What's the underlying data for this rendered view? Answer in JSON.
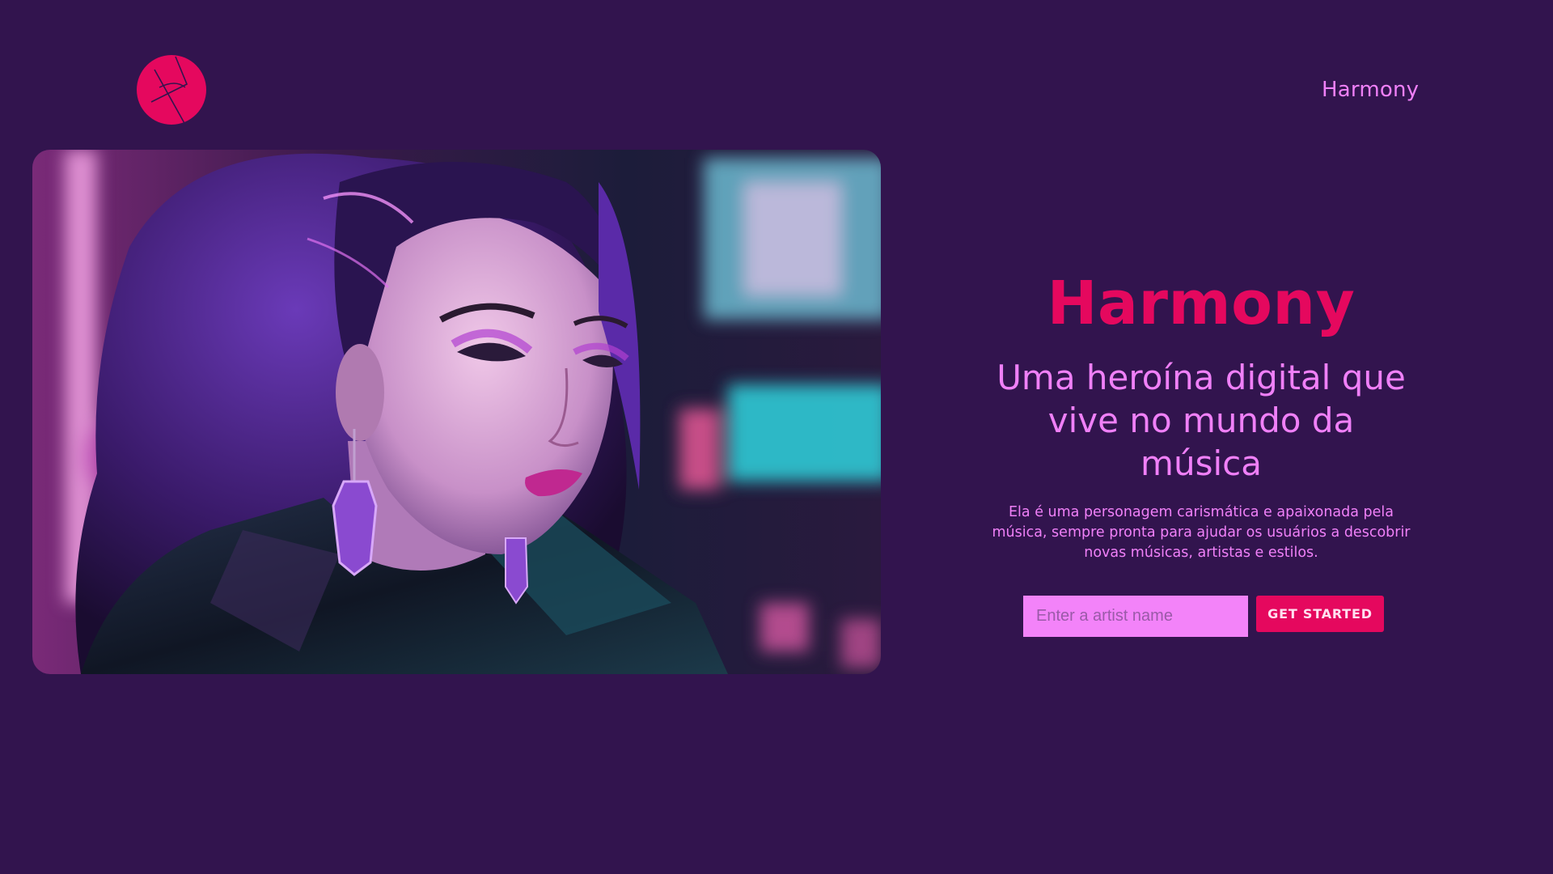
{
  "header": {
    "nav_link": "Harmony"
  },
  "hero": {
    "title": "Harmony",
    "subtitle": "Uma heroína digital que vive no mundo da música",
    "description": "Ela é uma personagem carismática e apaixonada pela música, sempre pronta para ajudar os usuários a descobrir novas músicas, artistas e estilos.",
    "input_placeholder": "Enter a artist name",
    "input_value": "",
    "cta_label": "GET STARTED"
  },
  "colors": {
    "background": "#32144e",
    "accent": "#e5085e",
    "text_pink": "#f080f8",
    "input_bg": "#f383f9"
  }
}
